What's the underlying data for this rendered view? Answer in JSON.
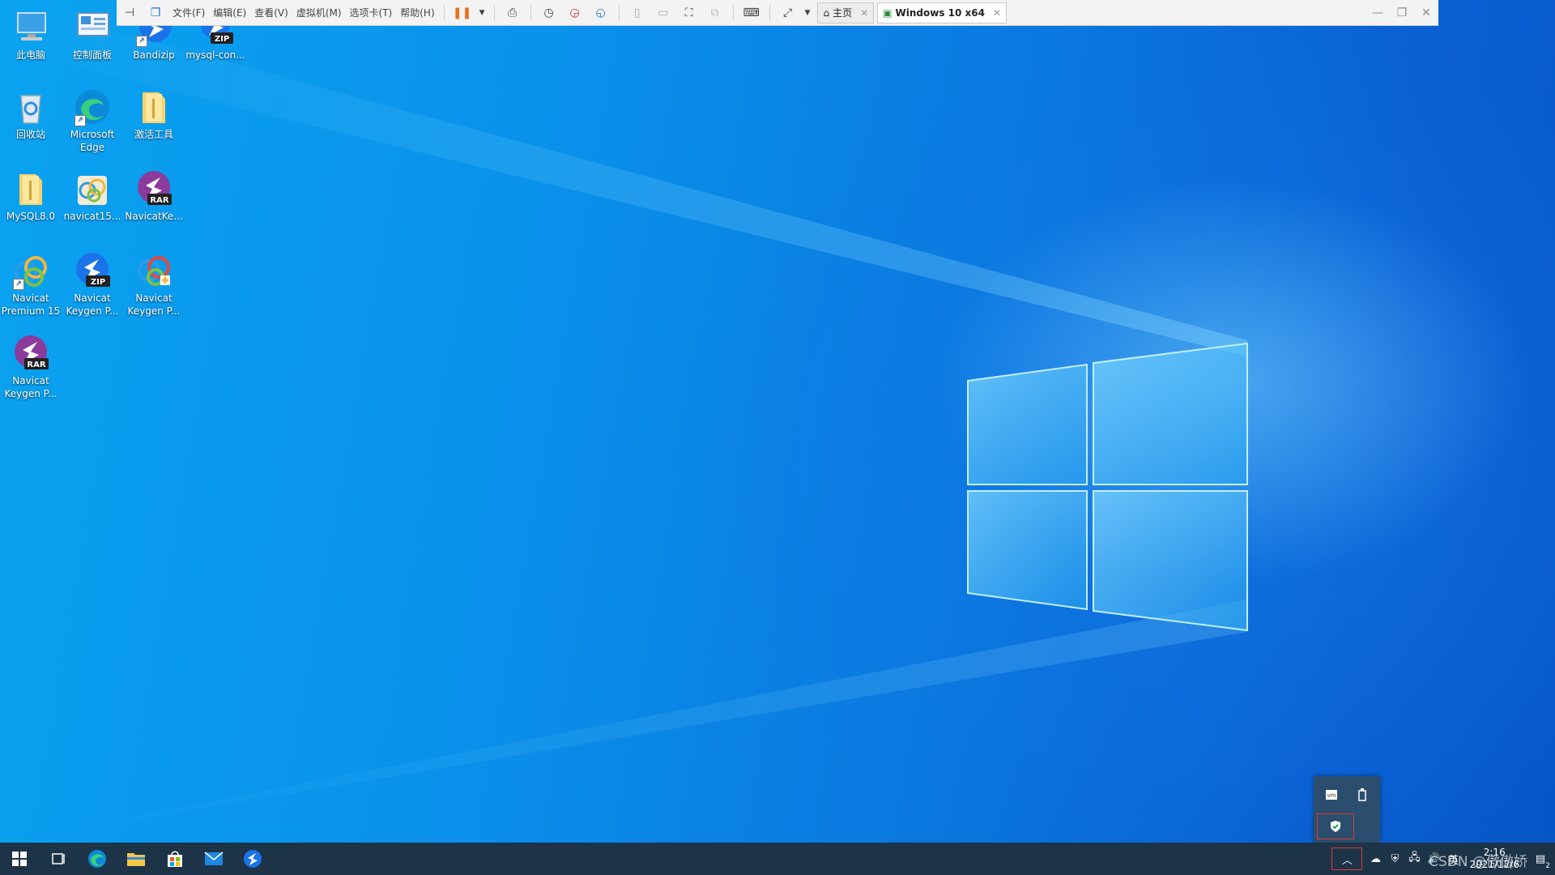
{
  "toolbar": {
    "menus": [
      "文件(F)",
      "编辑(E)",
      "查看(V)",
      "虚拟机(M)",
      "选项卡(T)",
      "帮助(H)"
    ],
    "tabs": [
      {
        "label": "主页",
        "icon": "home-icon"
      },
      {
        "label": "Windows 10 x64",
        "icon": "vm-icon"
      }
    ]
  },
  "desktop": {
    "icons": [
      {
        "label": "此电脑",
        "icon": "this-pc-icon"
      },
      {
        "label": "控制面板",
        "icon": "control-panel-icon"
      },
      {
        "label": "Bandizip",
        "icon": "bandizip-icon"
      },
      {
        "label": "mysql-con...",
        "icon": "zip-archive-icon",
        "badge": "ZIP"
      },
      {
        "label": "回收站",
        "icon": "recycle-bin-icon"
      },
      {
        "label": "Microsoft Edge",
        "icon": "edge-icon"
      },
      {
        "label": "激活工具",
        "icon": "folder-icon"
      },
      {
        "label": "MySQL8.0",
        "icon": "folder-icon"
      },
      {
        "label": "navicat15...",
        "icon": "navicat-installer-icon"
      },
      {
        "label": "NavicatKe...",
        "icon": "rar-archive-icon",
        "badge": "RAR"
      },
      {
        "label": "Navicat Premium 15",
        "icon": "navicat-icon"
      },
      {
        "label": "Navicat Keygen P...",
        "icon": "zip-archive-icon",
        "badge": "ZIP"
      },
      {
        "label": "Navicat Keygen P...",
        "icon": "navicat-keygen-icon"
      },
      {
        "label": "Navicat Keygen P...",
        "icon": "rar-archive-icon",
        "badge": "RAR"
      }
    ]
  },
  "taskbar": {
    "items": [
      "start-icon",
      "task-view-icon",
      "edge-icon",
      "file-explorer-icon",
      "store-icon",
      "mail-icon",
      "bandizip-icon"
    ],
    "tray": {
      "popup_cells": [
        {
          "label": "vm",
          "icon": "vmware-tools-icon"
        },
        {
          "label": "usb",
          "icon": "usb-icon"
        },
        {
          "label": "security",
          "icon": "windows-security-icon"
        }
      ],
      "time": "2:16",
      "date": "2021/12/6",
      "ime": "英",
      "notification_count": "2"
    }
  },
  "watermark": "CSDN @傲傲娇",
  "colors": {
    "taskbar": "#1c3348",
    "popup": "#2b4e6e",
    "popup_highlight": "#e03c31",
    "toolbar_bg": "#f3f3f3",
    "pause_orange": "#e8711a"
  }
}
